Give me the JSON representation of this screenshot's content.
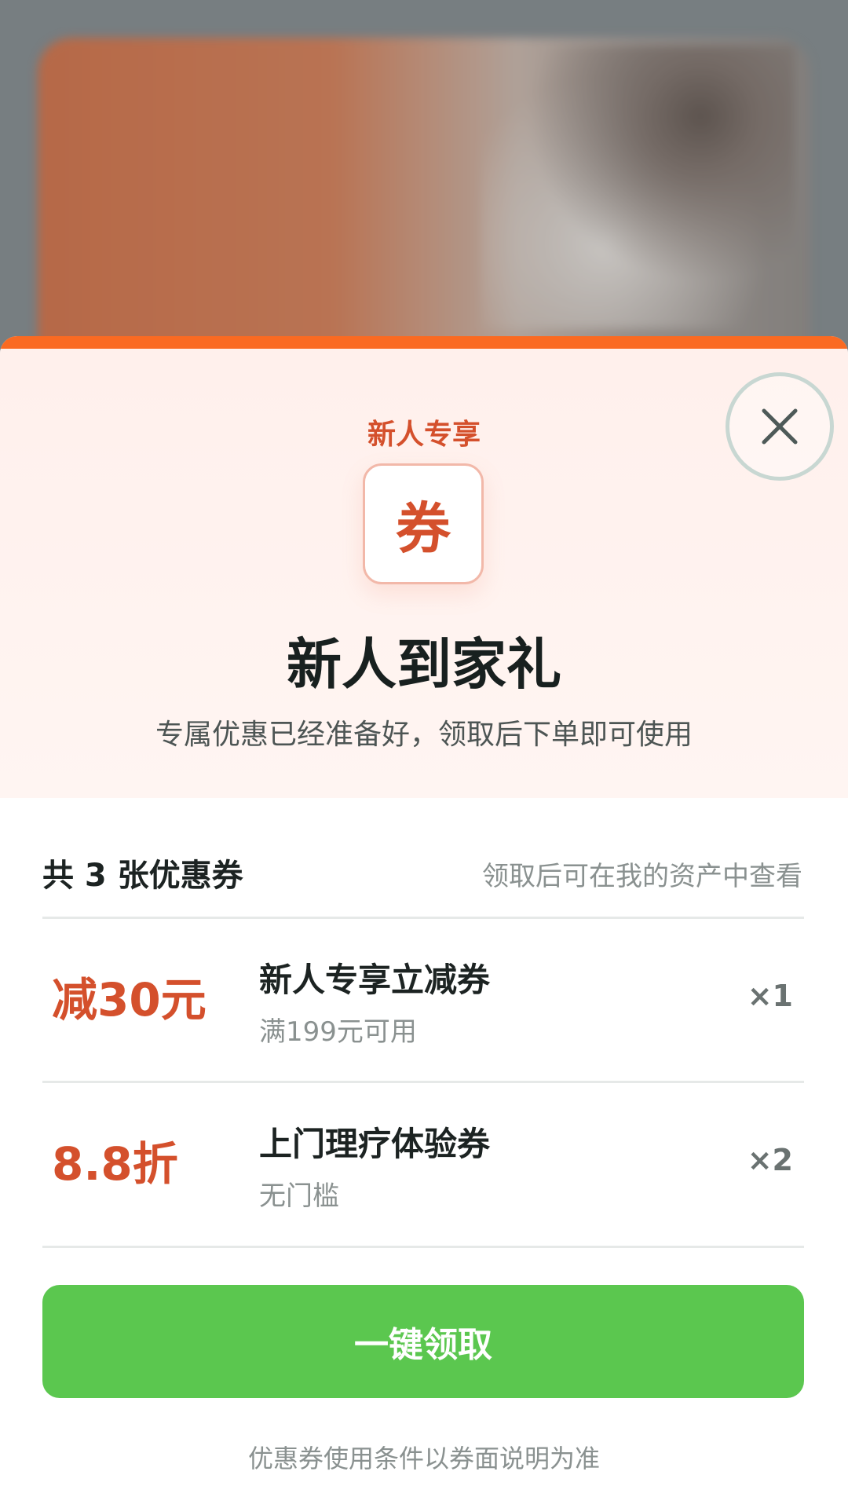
{
  "background_banner": {
    "colors": {
      "banner_orange": "#d2683a",
      "overlay_gray": "#7e8487"
    }
  },
  "sheet": {
    "accent_color": "#fa6a22",
    "close_icon": "close-icon",
    "eyebrow": "新人专享",
    "badge_char": "券",
    "title": "新人到家礼",
    "subtitle": "专属优惠已经准备好，领取后下单即可使用",
    "summary": {
      "count_label": "共 3 张优惠券",
      "hint": "领取后可在我的资产中查看"
    },
    "coupons": [
      {
        "amount": "减30元",
        "name": "新人专享立减券",
        "condition": "满199元可用",
        "qty": "×1"
      },
      {
        "amount": "8.8折",
        "name": "上门理疗体验券",
        "condition": "无门槛",
        "qty": "×2"
      }
    ],
    "claim_button": "一键领取",
    "footnote": "优惠券使用条件以券面说明为准",
    "colors": {
      "price_red": "#d4502c",
      "claim_green": "#5bc74f"
    }
  }
}
